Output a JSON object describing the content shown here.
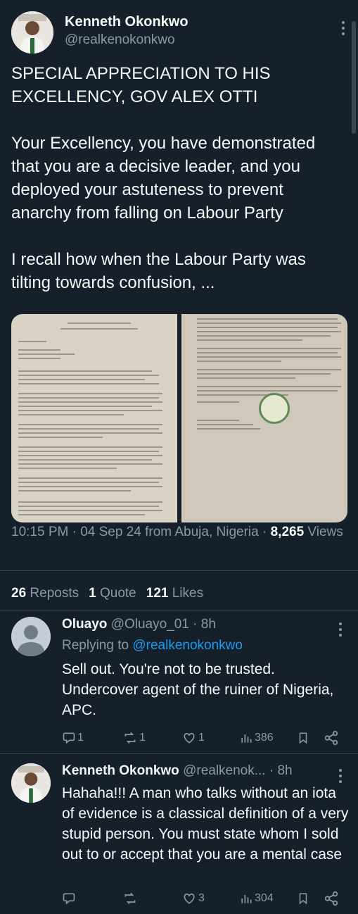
{
  "main_tweet": {
    "author_name": "Kenneth Okonkwo",
    "author_handle": "@realkenokonkwo",
    "text": "SPECIAL APPRECIATION TO HIS EXCELLENCY, GOV ALEX OTTI\n\nYour Excellency, you have demonstrated that you are a decisive leader, and you deployed your astuteness to prevent anarchy from falling on Labour Party\n\nI recall how when the Labour Party was tilting towards confusion, ...",
    "timestamp": "10:15 PM · 04 Sep 24 from Abuja, Nigeria · ",
    "views_count": "8,265",
    "views_label": "Views",
    "reposts_count": "26",
    "reposts_label": "Reposts",
    "quotes_count": "1",
    "quotes_label": "Quote",
    "likes_count": "121",
    "likes_label": "Likes"
  },
  "replies": [
    {
      "author_name": "Oluayo",
      "author_handle": "@Oluayo_01",
      "time": " · 8h",
      "replying_prefix": "Replying to ",
      "replying_to": "@realkenokonkwo",
      "text": "Sell out. You're not to be trusted. Undercover agent of the ruiner of Nigeria, APC.",
      "reply_count": "1",
      "repost_count": "1",
      "like_count": "1",
      "view_count": "386"
    },
    {
      "author_name": "Kenneth Okonkwo",
      "author_handle": "@realkenok...",
      "time": " · 8h",
      "text": "Hahaha!!! A man who talks without an iota of evidence is a classical definition of a very stupid person. You must state whom I sold out to or accept that you are a mental case",
      "reply_count": "",
      "repost_count": "",
      "like_count": "3",
      "view_count": "304"
    }
  ],
  "colors": {
    "background": "#15202b",
    "text": "#f7f9f9",
    "muted": "#8b98a5",
    "accent": "#1d9bf0",
    "divider": "#38444d"
  },
  "icons": [
    "more-icon",
    "reply-icon",
    "repost-icon",
    "like-icon",
    "views-icon",
    "bookmark-icon",
    "share-icon"
  ]
}
